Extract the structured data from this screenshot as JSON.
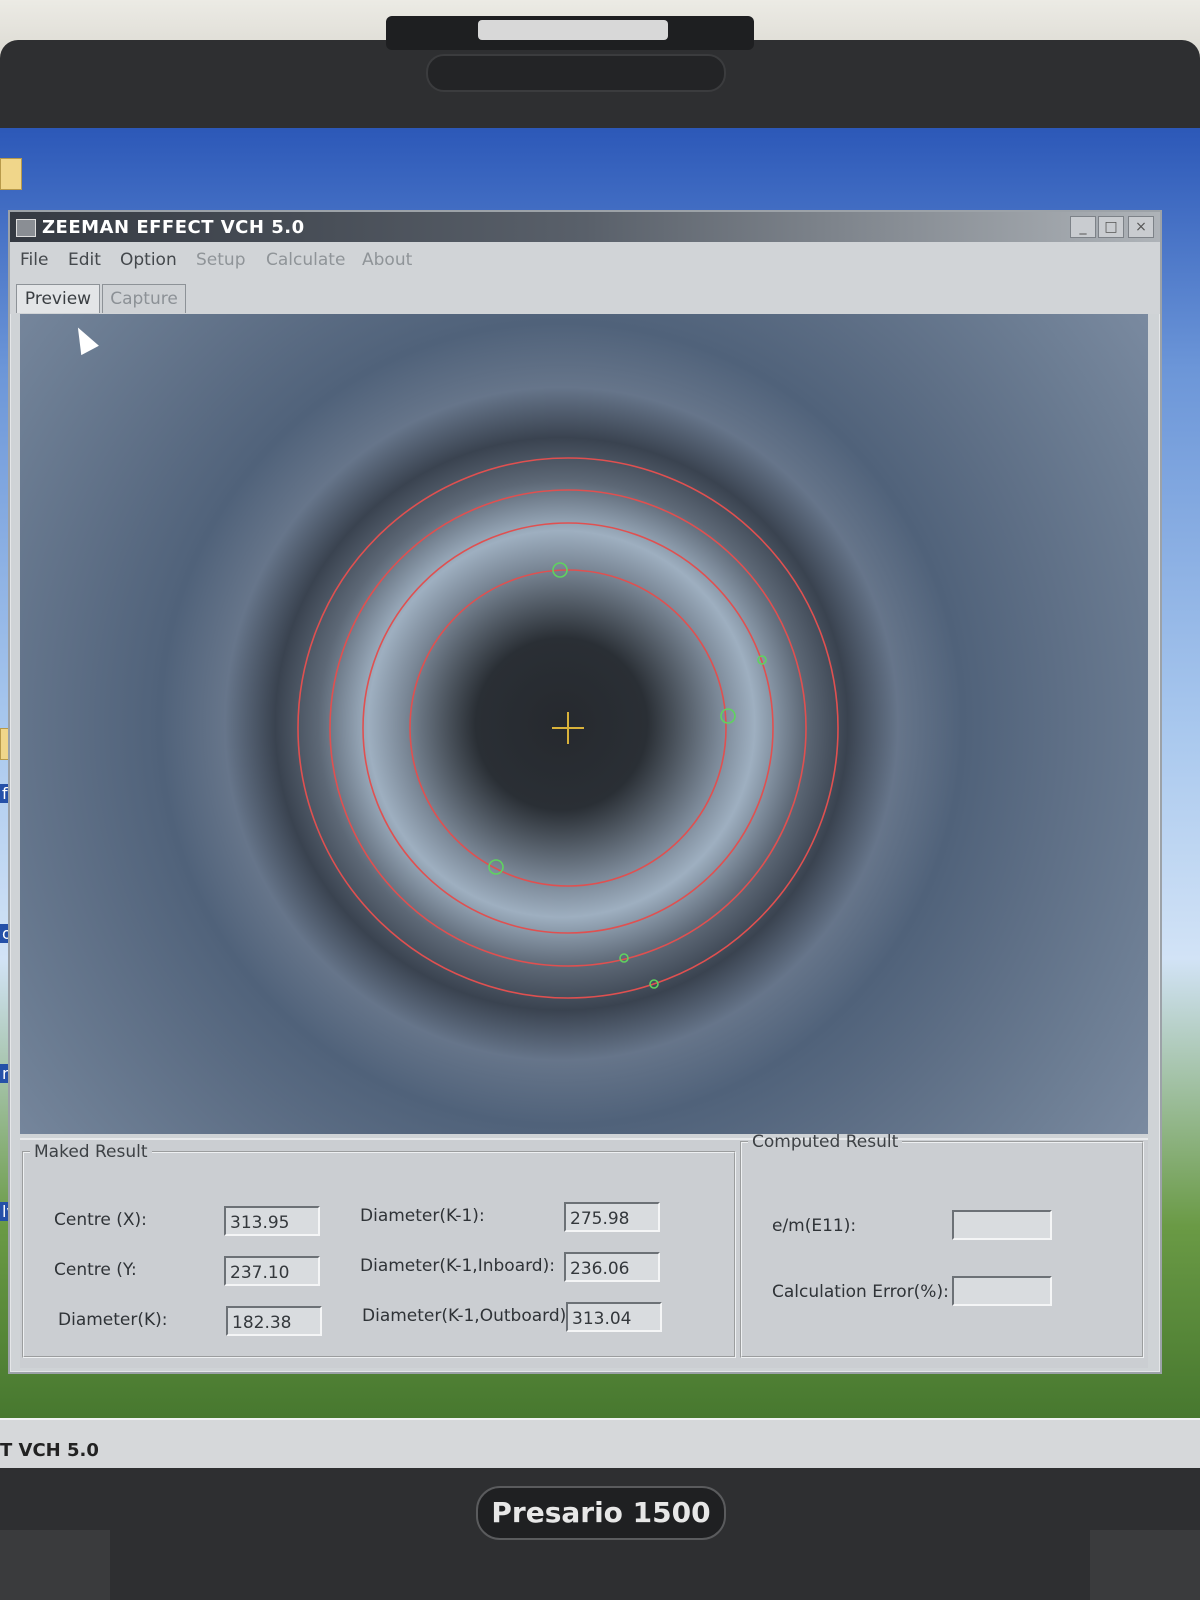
{
  "window": {
    "title": "ZEEMAN EFFECT VCH 5.0",
    "controls": [
      "minimize-icon",
      "maximize-icon",
      "close-icon"
    ]
  },
  "menu": [
    "File",
    "Edit",
    "Option",
    "Setup",
    "Calculate",
    "About"
  ],
  "tabs": [
    "Preview",
    "Capture"
  ],
  "active_tab": "Preview",
  "preview": {
    "rings": 4,
    "ring_color": "#e05050",
    "marker_color": "#5fd35f",
    "crosshair_color": "#d9b23a"
  },
  "maked_result": {
    "legend": "Maked Result",
    "centre_x_label": "Centre (X):",
    "centre_x": "313.95",
    "centre_y_label": "Centre (Y:",
    "centre_y": "237.10",
    "diameter_k_label": "Diameter(K):",
    "diameter_k": "182.38",
    "diameter_k1_label": "Diameter(K-1):",
    "diameter_k1": "275.98",
    "diameter_k1_in_label": "Diameter(K-1,Inboard):",
    "diameter_k1_in": "236.06",
    "diameter_k1_out_label": "Diameter(K-1,Outboard):",
    "diameter_k1_out": "313.04"
  },
  "computed_result": {
    "legend": "Computed Result",
    "em_label": "e/m(E11):",
    "em_value": "",
    "error_label": "Calculation Error(%):",
    "error_value": ""
  },
  "taskbar": {
    "item": "T VCH 5.0"
  },
  "desktop_labels": [
    "fp",
    "ots",
    "ngl",
    "lvar"
  ],
  "device": {
    "brand": "Presario 1500"
  }
}
